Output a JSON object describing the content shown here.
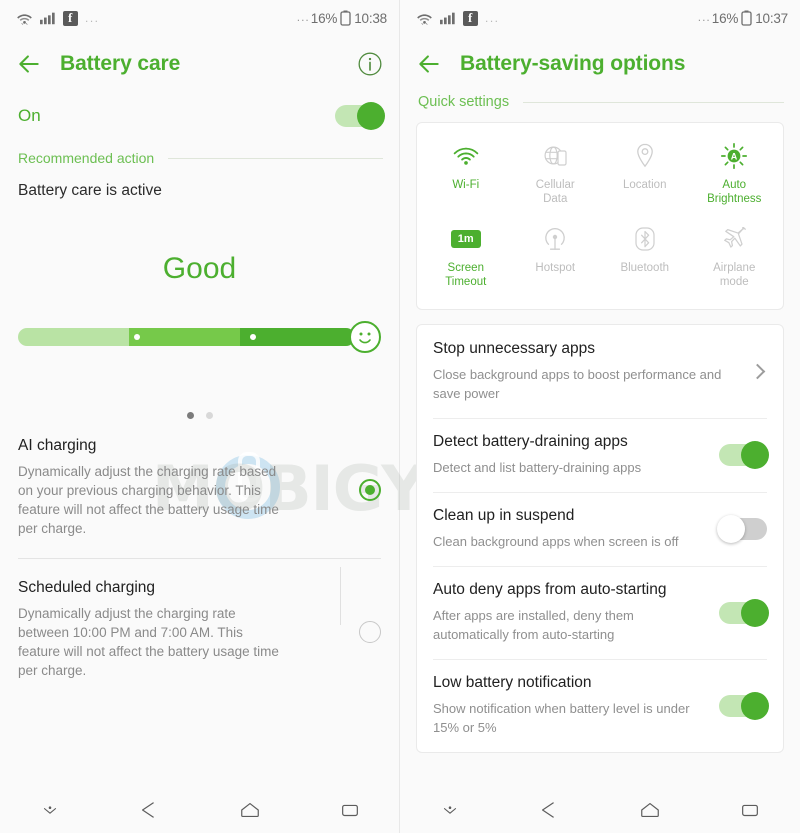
{
  "watermark": {
    "text": "MOBIGYAAN"
  },
  "left": {
    "statusbar": {
      "icons": [
        "wifi-icon",
        "signal-icon",
        "facebook-icon"
      ],
      "overflow": "...",
      "battery_prefix": "...",
      "battery": "16%",
      "battery_icon": "battery-icon",
      "time": "10:38"
    },
    "appbar": {
      "back": "back-arrow-icon",
      "title": "Battery care",
      "info": "info-icon"
    },
    "power": {
      "label": "On",
      "toggle_state": "on"
    },
    "section": {
      "label": "Recommended action"
    },
    "status_line": "Battery care is active",
    "rating": {
      "label": "Good",
      "level_pct": 100
    },
    "pager": {
      "dots": 2,
      "active": 0
    },
    "options": [
      {
        "title": "AI charging",
        "desc": "Dynamically adjust the charging rate based on your previous charging behavior. This feature will not affect the battery usage time per charge.",
        "selected": true
      },
      {
        "title": "Scheduled charging",
        "desc": "Dynamically adjust the charging rate between 10:00 PM and 7:00 AM. This feature will not affect the battery usage time per charge.",
        "selected": false
      }
    ],
    "nav": [
      "hide-nav-icon",
      "back-icon",
      "home-icon",
      "recents-icon"
    ]
  },
  "right": {
    "statusbar": {
      "overflow": "...",
      "battery_prefix": "...",
      "battery": "16%",
      "time": "10:37"
    },
    "appbar": {
      "back": "back-arrow-icon",
      "title": "Battery-saving options"
    },
    "quick_settings": {
      "label": "Quick settings",
      "tiles": [
        {
          "icon": "wifi-icon",
          "label": "Wi-Fi",
          "state": "on"
        },
        {
          "icon": "cellular-data-icon",
          "label": "Cellular\nData",
          "state": "off"
        },
        {
          "icon": "location-icon",
          "label": "Location",
          "state": "off"
        },
        {
          "icon": "auto-brightness-icon",
          "label": "Auto\nBrightness",
          "state": "on"
        },
        {
          "icon": "screen-timeout-icon",
          "label": "Screen\nTimeout",
          "state": "on",
          "badge": "1m"
        },
        {
          "icon": "hotspot-icon",
          "label": "Hotspot",
          "state": "off"
        },
        {
          "icon": "bluetooth-icon",
          "label": "Bluetooth",
          "state": "off"
        },
        {
          "icon": "airplane-mode-icon",
          "label": "Airplane\nmode",
          "state": "off"
        }
      ]
    },
    "settings": [
      {
        "title": "Stop unnecessary apps",
        "desc": "Close background apps to boost performance and save power",
        "control": "chevron"
      },
      {
        "title": "Detect battery-draining apps",
        "desc": "Detect and list battery-draining apps",
        "control": "toggle",
        "state": "on"
      },
      {
        "title": "Clean up in suspend",
        "desc": "Clean background apps when screen is off",
        "control": "toggle",
        "state": "off"
      },
      {
        "title": "Auto deny apps from auto-starting",
        "desc": "After apps are installed, deny them automatically from auto-starting",
        "control": "toggle",
        "state": "on"
      },
      {
        "title": "Low battery notification",
        "desc": "Show notification when battery level is under 15% or 5%",
        "control": "toggle",
        "state": "on"
      }
    ],
    "nav": [
      "hide-nav-icon",
      "back-icon",
      "home-icon",
      "recents-icon"
    ]
  },
  "colors": {
    "accent": "#4caf2f",
    "accent_light": "#c3e6b4",
    "bar_seg1": "#b9e3a4",
    "bar_seg2": "#76c94a",
    "bar_seg3": "#4caf2f",
    "inactive": "#bdbdbd",
    "background": "#fafafa"
  }
}
